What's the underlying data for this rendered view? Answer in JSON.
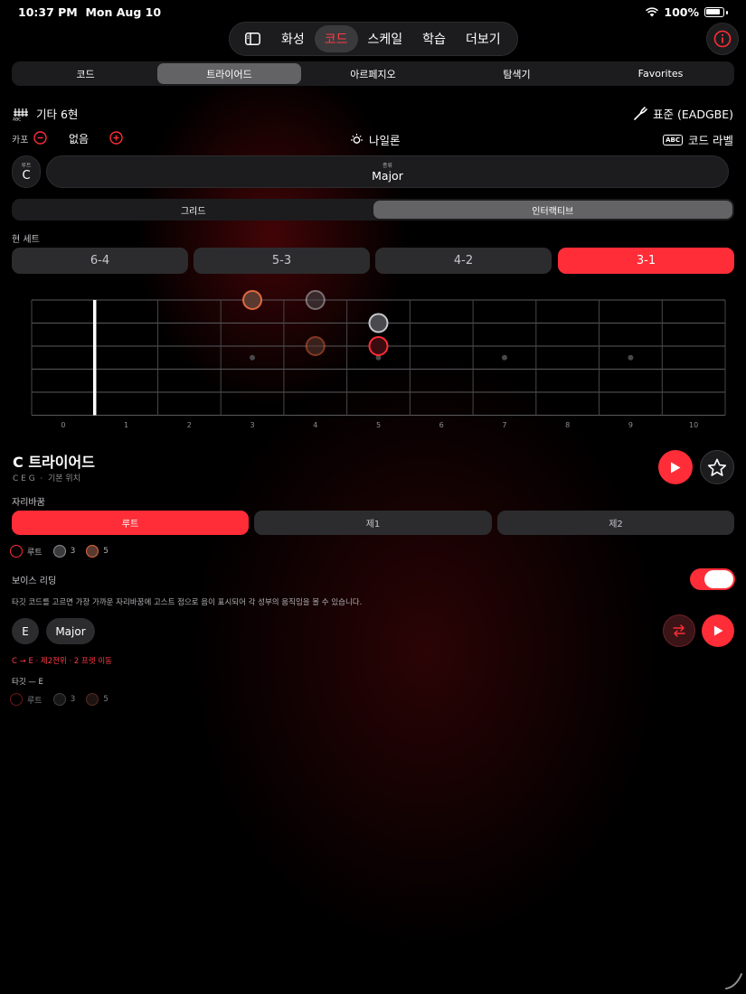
{
  "status_bar": {
    "time": "10:37 PM",
    "date": "Mon Aug 10",
    "battery": "100%"
  },
  "topnav": {
    "tabs": [
      "화성",
      "코드",
      "스케일",
      "학습",
      "더보기"
    ],
    "active": "코드"
  },
  "subtabs": {
    "items": [
      "코드",
      "트라이어드",
      "아르페지오",
      "탐색기",
      "Favorites"
    ],
    "active": "트라이어드"
  },
  "instrument": {
    "name": "기타 6현",
    "tuning": "표준 (EADGBE)"
  },
  "capo": {
    "label": "카포",
    "value": "없음"
  },
  "notation": {
    "label": "나일론"
  },
  "chord_label": {
    "badge": "ABC",
    "label": "코드 라벨"
  },
  "root_selector": {
    "label": "루트",
    "value": "C"
  },
  "type_selector": {
    "label": "종류",
    "value": "Major"
  },
  "view_toggle": {
    "options": [
      "그리드",
      "인터랙티브"
    ],
    "active": "인터랙티브"
  },
  "string_set": {
    "label": "현 세트",
    "options": [
      "6-4",
      "5-3",
      "4-2",
      "3-1"
    ],
    "active": "3-1"
  },
  "fretboard": {
    "fret_numbers": [
      "0",
      "1",
      "2",
      "3",
      "4",
      "5",
      "6",
      "7",
      "8",
      "9",
      "10"
    ],
    "inlay_frets": [
      3,
      5,
      7,
      9
    ],
    "dots": [
      {
        "string": 1,
        "fret": 3,
        "role": "5"
      },
      {
        "string": 1,
        "fret": 4,
        "role": "3",
        "ghost": true
      },
      {
        "string": 2,
        "fret": 5,
        "role": "3"
      },
      {
        "string": 3,
        "fret": 4,
        "role": "5",
        "ghost": true
      },
      {
        "string": 3,
        "fret": 5,
        "role": "root"
      }
    ]
  },
  "chord": {
    "title": "C 트라이어드",
    "notes": "C  E  G",
    "position": "기본 위치"
  },
  "inversion": {
    "label": "자리바꿈",
    "options": [
      "루트",
      "제1",
      "제2"
    ],
    "active": "루트"
  },
  "legend": [
    {
      "label": "루트",
      "color": "#ff2d37"
    },
    {
      "label": "3",
      "color": "#8e8e93"
    },
    {
      "label": "5",
      "color": "#e0683e"
    }
  ],
  "voice_leading": {
    "label": "보이스 리딩",
    "enabled": true,
    "description": "타깃 코드를 고르면 가장 가까운 자리바꿈에 고스트 점으로 음이 표시되어 각 성부의 움직임을 볼 수 있습니다.",
    "target_root": "E",
    "target_type": "Major",
    "movement": "C → E · 제2전위 · 2 프렛 이동",
    "target_label": "타깃 — E"
  },
  "target_legend": [
    {
      "label": "루트",
      "color": "#ff2d37"
    },
    {
      "label": "3",
      "color": "#8e8e93"
    },
    {
      "label": "5",
      "color": "#e0683e"
    }
  ],
  "colors": {
    "accent": "#ff2d37",
    "surface": "#1c1c1e",
    "surface_active": "#636366"
  },
  "icons": [
    "sidebar-icon",
    "info-icon",
    "guitar-icon",
    "tuning-fork-icon",
    "minus-circle-icon",
    "plus-circle-icon",
    "sun-icon",
    "play-icon",
    "star-icon",
    "swap-icon"
  ]
}
